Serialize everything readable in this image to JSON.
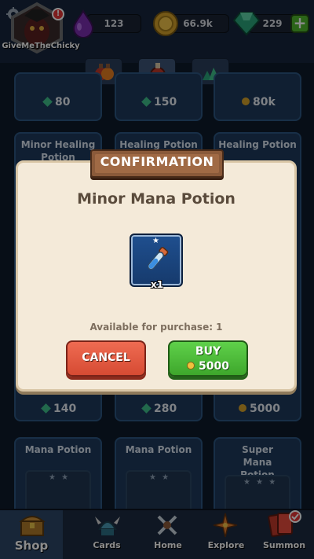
{
  "player": {
    "username": "GiveMeTheChicky",
    "alert_badge": "!"
  },
  "resources": {
    "mana": {
      "value": "123",
      "icon": "mana-drop-icon",
      "color": "#7a2fb0"
    },
    "coins": {
      "value": "66.9k",
      "icon": "coin-icon",
      "color": "#d4a02a"
    },
    "gems": {
      "value": "229",
      "icon": "gem-icon",
      "color": "#2aa57a"
    },
    "add_label": "+"
  },
  "tabs": [
    {
      "icon": "potion-bundle-icon"
    },
    {
      "icon": "potion-icon",
      "active": true
    },
    {
      "icon": "gem-pile-icon"
    }
  ],
  "shop": {
    "row1_prices": [
      {
        "currency": "gem",
        "value": "80"
      },
      {
        "currency": "gem",
        "value": "150"
      },
      {
        "currency": "coin",
        "value": "80k"
      }
    ],
    "row2_titles": [
      "Minor Healing Potion",
      "Healing Potion",
      "Healing Potion"
    ],
    "row2_prices": [
      {
        "currency": "gem",
        "value": "140"
      },
      {
        "currency": "gem",
        "value": "280"
      },
      {
        "currency": "coin",
        "value": "5000"
      }
    ],
    "row3_titles": [
      "Mana Potion",
      "Mana Potion",
      "Super Mana Potion"
    ],
    "row3_stars": [
      "★ ★",
      "★ ★",
      "★ ★ ★"
    ]
  },
  "dialog": {
    "title": "CONFIRMATION",
    "item_name": "Minor Mana Potion",
    "quantity": "x1",
    "availability": "Available for purchase: 1",
    "cancel_label": "CANCEL",
    "buy_label": "BUY",
    "buy_price": "5000"
  },
  "nav": {
    "shop": "Shop",
    "cards": "Cards",
    "home": "Home",
    "explore": "Explore",
    "summon": "Summon"
  }
}
